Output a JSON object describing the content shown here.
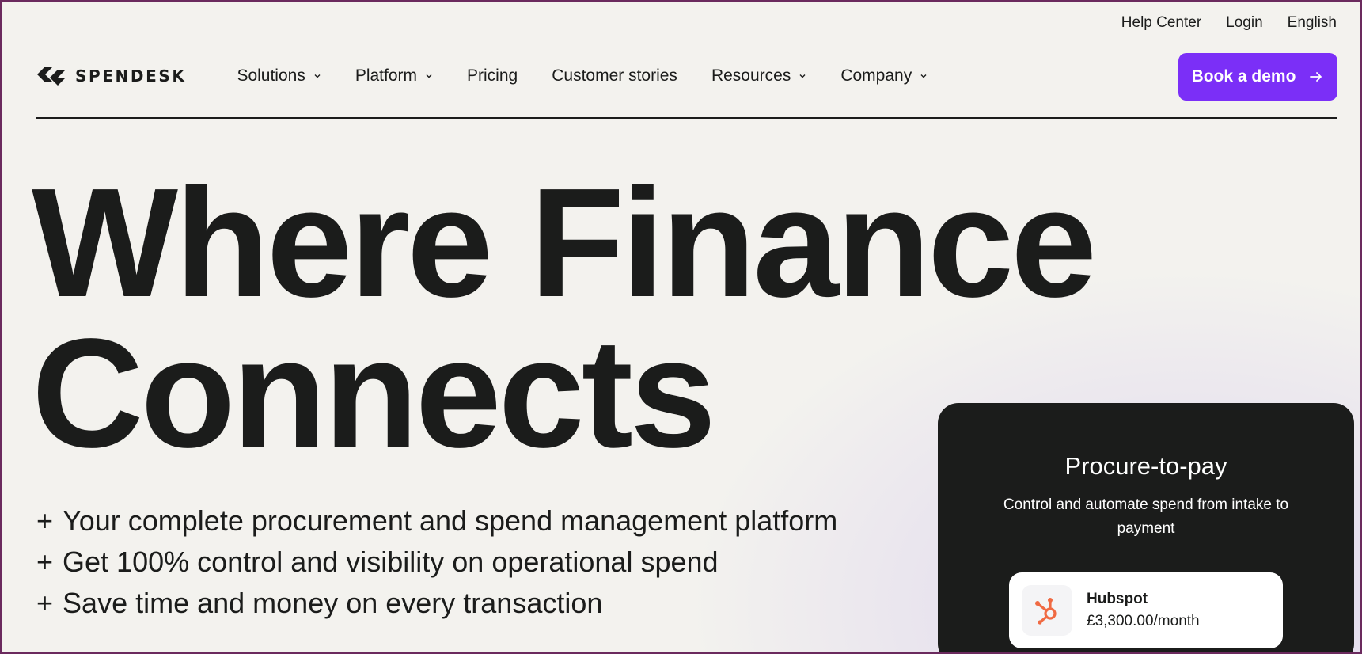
{
  "utility": {
    "help": "Help Center",
    "login": "Login",
    "language": "English"
  },
  "brand": {
    "name": "SPENDESK",
    "logo_icon": "spendesk-logo-icon"
  },
  "nav": {
    "items": [
      {
        "label": "Solutions",
        "dropdown": true
      },
      {
        "label": "Platform",
        "dropdown": true
      },
      {
        "label": "Pricing",
        "dropdown": false
      },
      {
        "label": "Customer stories",
        "dropdown": false
      },
      {
        "label": "Resources",
        "dropdown": true
      },
      {
        "label": "Company",
        "dropdown": true
      }
    ],
    "cta_label": "Book a demo",
    "cta_icon": "arrow-right-icon"
  },
  "hero": {
    "title_line1": "Where Finance",
    "title_line2": "Connects",
    "bullets": [
      "Your complete procurement and spend management platform",
      "Get 100% control and visibility on operational spend",
      "Save time and money on every transaction"
    ],
    "bullet_marker": "+"
  },
  "card": {
    "title": "Procure-to-pay",
    "subtitle": "Control and automate spend from intake to payment",
    "item": {
      "name": "Hubspot",
      "price": "£3,300.00/month",
      "icon": "hubspot-icon"
    }
  },
  "colors": {
    "accent": "#7b2ff7",
    "text": "#1b1c1b",
    "background": "#f3f2ee",
    "card": "#1b1c1b",
    "hubspot": "#f06a43"
  }
}
